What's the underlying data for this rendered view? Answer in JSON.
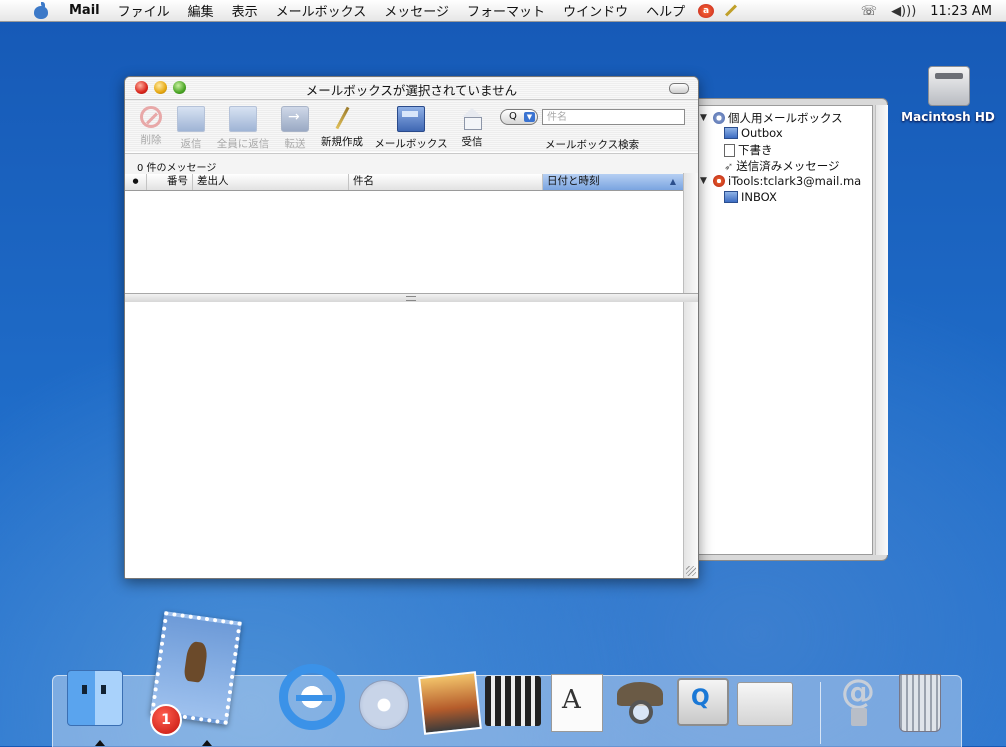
{
  "menubar": {
    "app_name": "Mail",
    "items": [
      "ファイル",
      "編集",
      "表示",
      "メールボックス",
      "メッセージ",
      "フォーマット",
      "ウインドウ",
      "ヘルプ"
    ],
    "clock": "11:23 AM",
    "extras_icons": [
      "apple-icon",
      "red-app-icon",
      "pen-icon",
      "phone-icon",
      "volume-icon"
    ]
  },
  "desktop": {
    "disk_label": "Macintosh HD"
  },
  "window": {
    "title": "メールボックスが選択されていません",
    "toolbar": {
      "delete_label": "削除",
      "reply_label": "返信",
      "reply_all_label": "全員に返信",
      "forward_label": "転送",
      "compose_label": "新規作成",
      "mailbox_label": "メールボックス",
      "get_mail_label": "受信",
      "search_placeholder": "件名",
      "search_label": "メールボックス検索",
      "search_menu_glyph": "Q"
    },
    "message_count": "0 件のメッセージ",
    "columns": {
      "status": "●",
      "number": "番号",
      "from": "差出人",
      "subject": "件名",
      "date": "日付と時刻",
      "sort_arrow": "▲"
    }
  },
  "drawer": {
    "personal_mailboxes": "個人用メールボックス",
    "outbox": "Outbox",
    "drafts": "下書き",
    "sent": "送信済みメッセージ",
    "itools_account": "iTools:tclark3@mail.ma",
    "inbox": "INBOX"
  },
  "dock": {
    "mail_badge": "1",
    "items": [
      "finder-icon",
      "mail-icon",
      "internet-explorer-icon",
      "itunes-icon",
      "iphoto-icon",
      "imovie-icon",
      "textedit-icon",
      "sherlock-icon",
      "quicktime-icon",
      "system-preferences-icon",
      "mail-at-icon",
      "trash-icon"
    ]
  },
  "colors": {
    "desktop": "#1f6cc8",
    "selection": "#7aa4e0",
    "badge": "#c3120c"
  }
}
